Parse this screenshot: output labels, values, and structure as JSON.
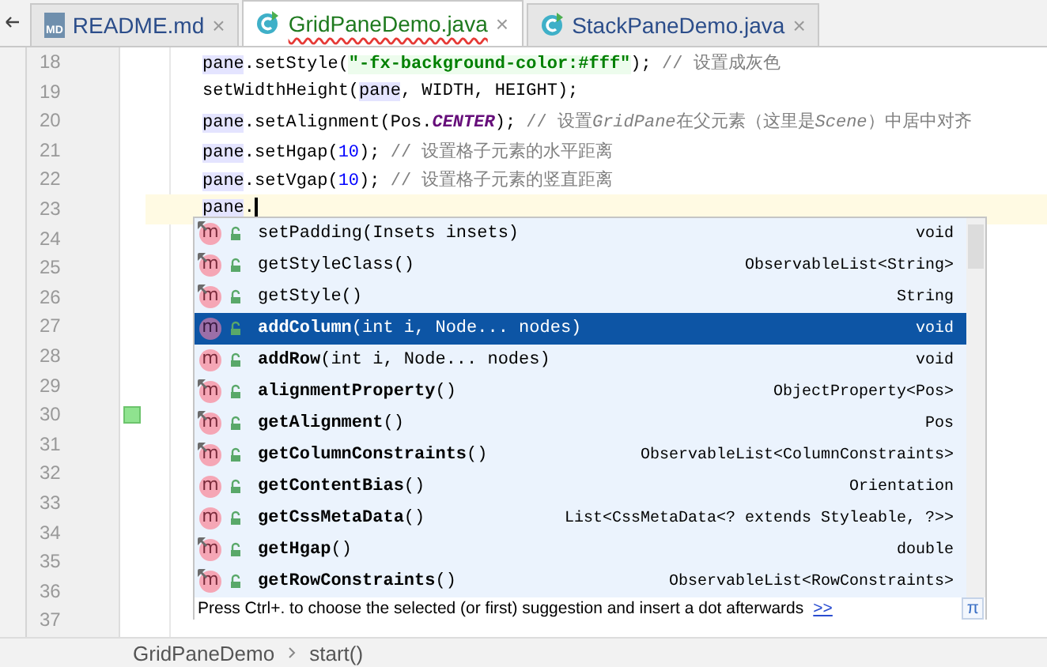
{
  "tabs": [
    {
      "label": "README.md",
      "kind": "markdown",
      "badge": "MD",
      "close": "×",
      "selected": false,
      "error": false
    },
    {
      "label": "GridPaneDemo.java",
      "kind": "java",
      "close": "×",
      "selected": true,
      "error": true
    },
    {
      "label": "StackPaneDemo.java",
      "kind": "java",
      "close": "×",
      "selected": false,
      "error": false
    }
  ],
  "editor": {
    "lines": [
      {
        "number": "18",
        "current": false,
        "bookmark": false,
        "tokens": [
          {
            "kind": "var",
            "text": "pane"
          },
          {
            "kind": "plain",
            "text": ".setStyle("
          },
          {
            "kind": "string",
            "text": "\"-fx-background-color:#fff\""
          },
          {
            "kind": "plain",
            "text": "); "
          },
          {
            "kind": "comment",
            "text": "// 设置成灰色"
          }
        ]
      },
      {
        "number": "19",
        "current": false,
        "bookmark": false,
        "tokens": [
          {
            "kind": "plain",
            "text": "setWidthHeight("
          },
          {
            "kind": "var",
            "text": "pane"
          },
          {
            "kind": "plain",
            "text": ", WIDTH, HEIGHT);"
          }
        ]
      },
      {
        "number": "20",
        "current": false,
        "bookmark": false,
        "tokens": [
          {
            "kind": "var",
            "text": "pane"
          },
          {
            "kind": "plain",
            "text": ".setAlignment(Pos."
          },
          {
            "kind": "constant",
            "text": "CENTER"
          },
          {
            "kind": "plain",
            "text": "); "
          },
          {
            "kind": "comment",
            "text": "// 设置"
          },
          {
            "kind": "comment-italic",
            "text": "GridPane"
          },
          {
            "kind": "comment",
            "text": "在父元素（这里是"
          },
          {
            "kind": "comment-italic",
            "text": "Scene"
          },
          {
            "kind": "comment",
            "text": "）中居中对齐"
          }
        ]
      },
      {
        "number": "21",
        "current": false,
        "bookmark": false,
        "tokens": [
          {
            "kind": "var",
            "text": "pane"
          },
          {
            "kind": "plain",
            "text": ".setHgap("
          },
          {
            "kind": "number",
            "text": "10"
          },
          {
            "kind": "plain",
            "text": "); "
          },
          {
            "kind": "comment",
            "text": "// 设置格子元素的水平距离"
          }
        ]
      },
      {
        "number": "22",
        "current": false,
        "bookmark": false,
        "tokens": [
          {
            "kind": "var",
            "text": "pane"
          },
          {
            "kind": "plain",
            "text": ".setVgap("
          },
          {
            "kind": "number",
            "text": "10"
          },
          {
            "kind": "plain",
            "text": "); "
          },
          {
            "kind": "comment",
            "text": "// 设置格子元素的竖直距离"
          }
        ]
      },
      {
        "number": "23",
        "current": true,
        "bookmark": false,
        "tokens": [
          {
            "kind": "var",
            "text": "pane"
          },
          {
            "kind": "plain",
            "text": "."
          }
        ]
      },
      {
        "number": "24",
        "current": false,
        "bookmark": false
      },
      {
        "number": "25",
        "current": false,
        "bookmark": false
      },
      {
        "number": "26",
        "current": false,
        "bookmark": false
      },
      {
        "number": "27",
        "current": false,
        "bookmark": false
      },
      {
        "number": "28",
        "current": false,
        "bookmark": false
      },
      {
        "number": "29",
        "current": false,
        "bookmark": false
      },
      {
        "number": "30",
        "current": false,
        "bookmark": true
      },
      {
        "number": "31",
        "current": false,
        "bookmark": false
      },
      {
        "number": "32",
        "current": false,
        "bookmark": false
      },
      {
        "number": "33",
        "current": false,
        "bookmark": false
      },
      {
        "number": "34",
        "current": false,
        "bookmark": false
      },
      {
        "number": "35",
        "current": false,
        "bookmark": false
      },
      {
        "number": "36",
        "current": false,
        "bookmark": false
      },
      {
        "number": "37",
        "current": false,
        "bookmark": false
      }
    ]
  },
  "completion": {
    "items": [
      {
        "icon": "m",
        "signature": "setPadding(Insets insets)",
        "type": "void",
        "overridden": true,
        "selected": false
      },
      {
        "icon": "m",
        "signature": "getStyleClass()",
        "type": "ObservableList<String>",
        "overridden": true,
        "selected": false
      },
      {
        "icon": "m",
        "signature": "getStyle()",
        "type": "String",
        "overridden": true,
        "selected": false
      },
      {
        "icon": "m",
        "signature": "**addColumn**(int i, Node... nodes)",
        "type": "void",
        "overridden": false,
        "selected": true
      },
      {
        "icon": "m",
        "signature": "**addRow**(int i, Node... nodes)",
        "type": "void",
        "overridden": false,
        "selected": false
      },
      {
        "icon": "m",
        "signature": "**alignmentProperty**()",
        "type": "ObjectProperty<Pos>",
        "overridden": true,
        "selected": false
      },
      {
        "icon": "m",
        "signature": "**getAlignment**()",
        "type": "Pos",
        "overridden": true,
        "selected": false
      },
      {
        "icon": "m",
        "signature": "**getColumnConstraints**()",
        "type": "ObservableList<ColumnConstraints>",
        "overridden": true,
        "selected": false
      },
      {
        "icon": "m",
        "signature": "**getContentBias**()",
        "type": "Orientation",
        "overridden": false,
        "selected": false
      },
      {
        "icon": "m",
        "signature": "**getCssMetaData**()",
        "type": "List<CssMetaData<? extends Styleable, ?>>",
        "overridden": false,
        "selected": false
      },
      {
        "icon": "m",
        "signature": "**getHgap**()",
        "type": "double",
        "overridden": true,
        "selected": false
      },
      {
        "icon": "m",
        "signature": "**getRowConstraints**()",
        "type": "ObservableList<RowConstraints>",
        "overridden": true,
        "selected": false
      }
    ],
    "hint": "Press Ctrl+. to choose the selected (or first) suggestion and insert a dot afterwards",
    "hint_link": ">>",
    "pi_button": "π"
  },
  "breadcrumb": [
    "GridPaneDemo",
    "start()"
  ]
}
